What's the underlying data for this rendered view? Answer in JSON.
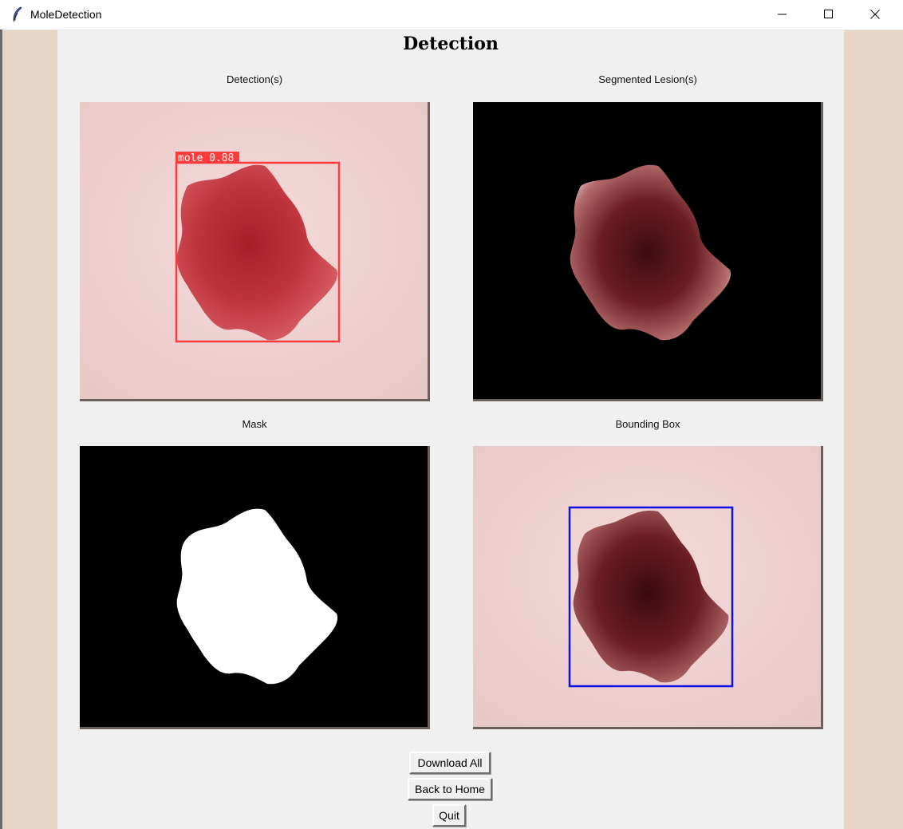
{
  "window": {
    "title": "MoleDetection",
    "icon": "feather-icon",
    "controls": {
      "minimize": "minimize-icon",
      "maximize": "maximize-icon",
      "close": "close-icon"
    }
  },
  "page": {
    "heading": "Detection"
  },
  "panels": {
    "detections": {
      "label": "Detection(s)",
      "detection_label": "mole  0.88",
      "box_color": "#ff3b3b"
    },
    "segmented": {
      "label": "Segmented Lesion(s)"
    },
    "mask": {
      "label": "Mask"
    },
    "bounding_box": {
      "label": "Bounding Box",
      "box_color": "#1010e0"
    }
  },
  "buttons": {
    "download_all": "Download All",
    "back_to_home": "Back to Home",
    "quit": "Quit"
  },
  "colors": {
    "background": "#e6d6c5",
    "content": "#f0f0f0",
    "skin": "#f1d3d3"
  }
}
